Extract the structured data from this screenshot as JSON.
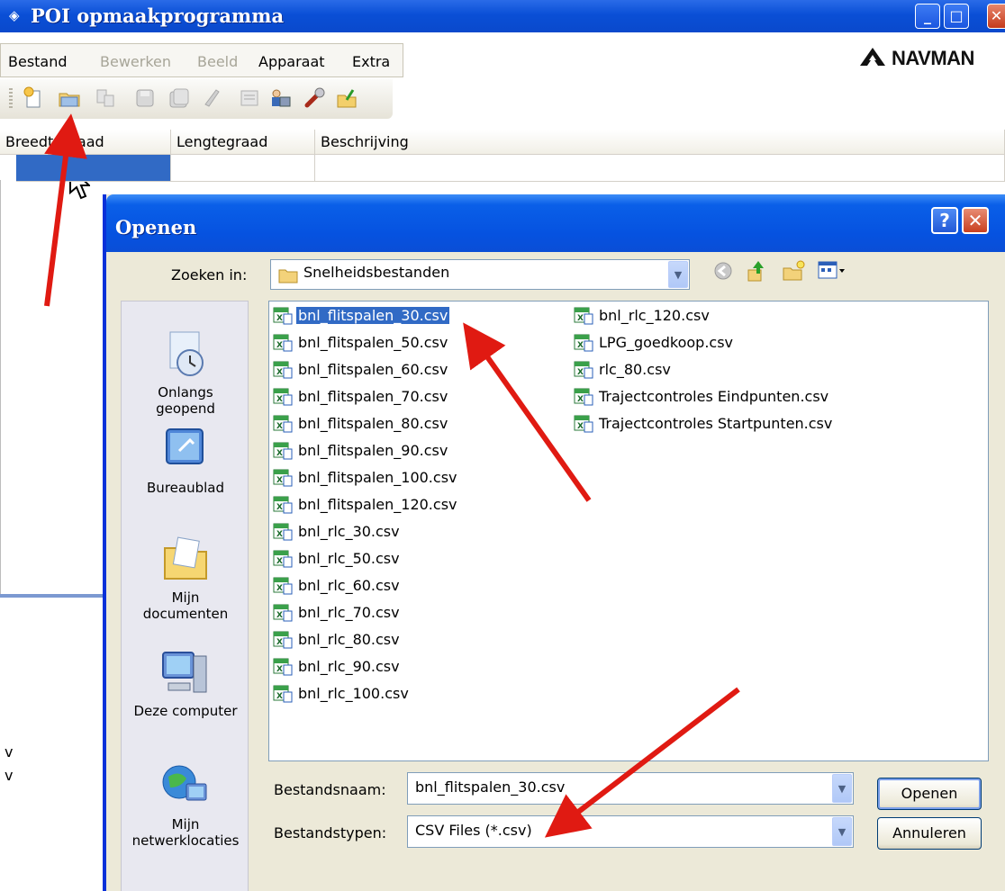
{
  "window": {
    "title": "POI opmaakprogramma",
    "brand": "NAVMAN"
  },
  "menu": {
    "items": [
      {
        "label": "Bestand",
        "enabled": true
      },
      {
        "label": "Bewerken",
        "enabled": false
      },
      {
        "label": "Beeld",
        "enabled": false
      },
      {
        "label": "Apparaat",
        "enabled": true
      },
      {
        "label": "Extra",
        "enabled": true
      }
    ]
  },
  "toolbar": {
    "icons": [
      "new-icon",
      "open-folder-icon",
      "copy-icon",
      "save-icon",
      "save-as-icon",
      "delete-icon",
      "list-icon",
      "users-icon",
      "wrench-icon",
      "export-icon"
    ]
  },
  "grid": {
    "columns": [
      "Breedtegraad",
      "Lengtegraad",
      "Beschrijving"
    ]
  },
  "background_text": [
    "v",
    "v"
  ],
  "dialog": {
    "title": "Openen",
    "help": "?",
    "close": "✕",
    "look_in_label": "Zoeken in:",
    "look_in_value": "Snelheidsbestanden",
    "places": [
      {
        "label": "Onlangs\ngeopend",
        "icon": "recent-icon"
      },
      {
        "label": "Bureaublad",
        "icon": "desktop-icon"
      },
      {
        "label": "Mijn\ndocumenten",
        "icon": "my-documents-icon"
      },
      {
        "label": "Deze computer",
        "icon": "computer-icon"
      },
      {
        "label": "Mijn\nnetwerklocaties",
        "icon": "network-icon"
      }
    ],
    "files_col1": [
      "bnl_flitspalen_30.csv",
      "bnl_flitspalen_50.csv",
      "bnl_flitspalen_60.csv",
      "bnl_flitspalen_70.csv",
      "bnl_flitspalen_80.csv",
      "bnl_flitspalen_90.csv",
      "bnl_flitspalen_100.csv",
      "bnl_flitspalen_120.csv",
      "bnl_rlc_30.csv",
      "bnl_rlc_50.csv",
      "bnl_rlc_60.csv",
      "bnl_rlc_70.csv",
      "bnl_rlc_80.csv",
      "bnl_rlc_90.csv",
      "bnl_rlc_100.csv"
    ],
    "files_col2": [
      "bnl_rlc_120.csv",
      "LPG_goedkoop.csv",
      "rlc_80.csv",
      "Trajectcontroles Eindpunten.csv",
      "Trajectcontroles Startpunten.csv"
    ],
    "selected_file": "bnl_flitspalen_30.csv",
    "filename_label": "Bestandsnaam:",
    "filename_value": "bnl_flitspalen_30.csv",
    "filetype_label": "Bestandstypen:",
    "filetype_value": "CSV Files (*.csv)",
    "open_button": "Openen",
    "cancel_button": "Annuleren"
  },
  "colors": {
    "titlebar": "#0a4fd6",
    "selection": "#316ac5",
    "arrow": "#e01a12",
    "dialog_bg": "#ece9d8"
  }
}
